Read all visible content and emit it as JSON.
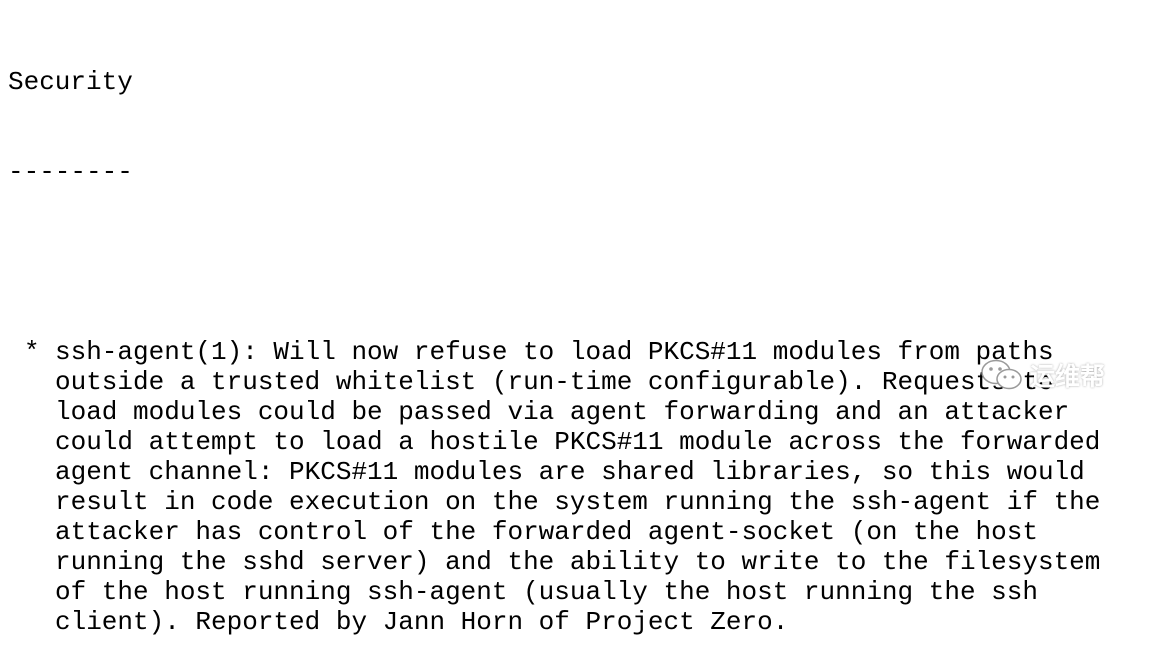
{
  "section": {
    "title": "Security",
    "underline": "--------"
  },
  "item": {
    "bullet": "*",
    "lines": [
      "ssh-agent(1): Will now refuse to load PKCS#11 modules from paths",
      "outside a trusted whitelist (run-time configurable). Requests to",
      "load modules could be passed via agent forwarding and an attacker",
      "could attempt to load a hostile PKCS#11 module across the forwarded",
      "agent channel: PKCS#11 modules are shared libraries, so this would",
      "result in code execution on the system running the ssh-agent if the",
      "attacker has control of the forwarded agent-socket (on the host",
      "running the sshd server) and the ability to write to the filesystem",
      "of the host running ssh-agent (usually the host running the ssh",
      "client). Reported by Jann Horn of Project Zero."
    ]
  },
  "watermark": {
    "icon": "wechat-icon",
    "text": "运维帮"
  }
}
